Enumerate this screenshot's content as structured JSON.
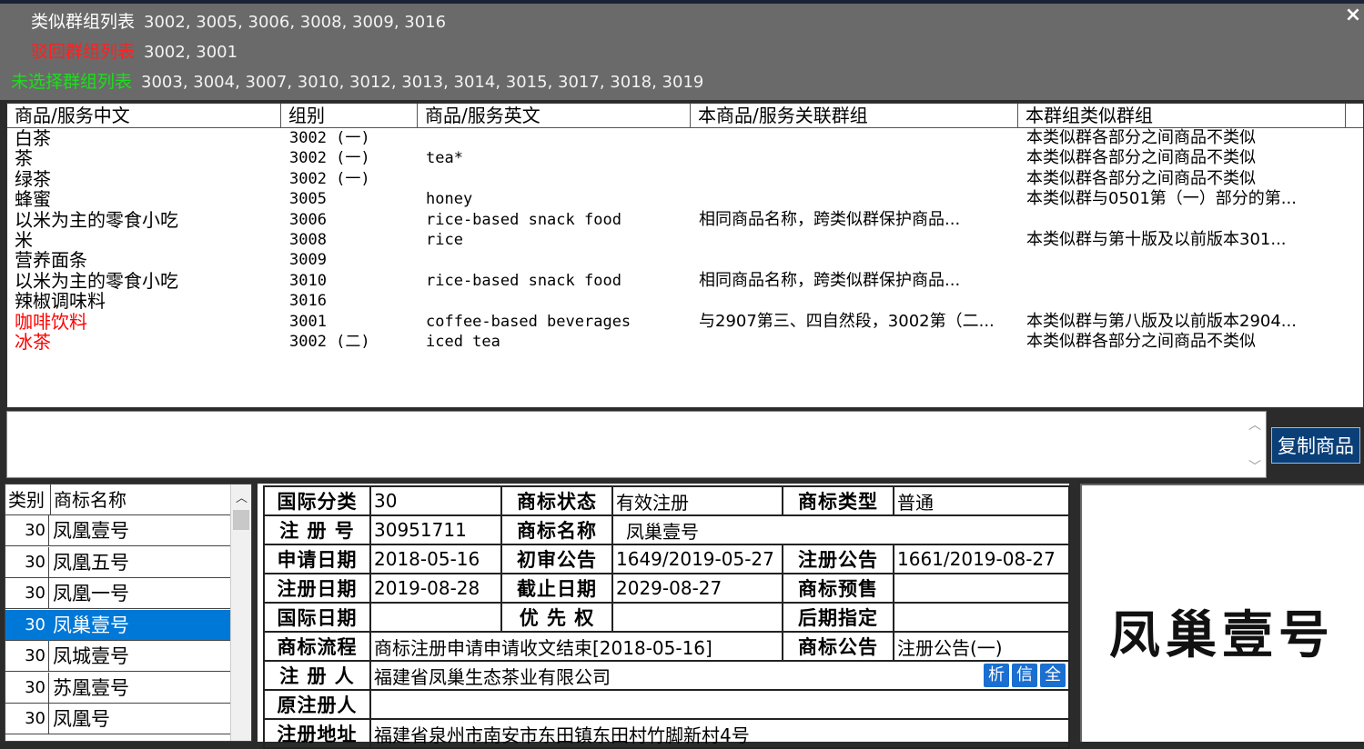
{
  "top": {
    "similar_label": "类似群组列表",
    "similar_values": "3002, 3005, 3006, 3008, 3009, 3016",
    "rejected_label": "驳回群组列表",
    "rejected_values": "3002, 3001",
    "unselected_label": "未选择群组列表",
    "unselected_values": "3003, 3004, 3007, 3010, 3012, 3013, 3014, 3015, 3017, 3018, 3019",
    "colors": {
      "similar": "#ffffff",
      "rejected": "#ff2020",
      "unselected": "#19e019"
    }
  },
  "close_icon": "×",
  "goods_table": {
    "headers": [
      "商品/服务中文",
      "组别",
      "商品/服务英文",
      "本商品/服务关联群组",
      "本群组类似群组"
    ],
    "rows": [
      {
        "cn": "白茶",
        "group": "3002 (一)",
        "en": "",
        "rel": "",
        "sim": "本类似群各部分之间商品不类似",
        "red": false
      },
      {
        "cn": "茶",
        "group": "3002 (一)",
        "en": "tea*",
        "rel": "",
        "sim": "本类似群各部分之间商品不类似",
        "red": false
      },
      {
        "cn": "绿茶",
        "group": "3002 (一)",
        "en": "",
        "rel": "",
        "sim": "本类似群各部分之间商品不类似",
        "red": false
      },
      {
        "cn": "蜂蜜",
        "group": "3005",
        "en": "honey",
        "rel": "",
        "sim": "本类似群与0501第（一）部分的第...",
        "red": false
      },
      {
        "cn": "以米为主的零食小吃",
        "group": "3006",
        "en": "rice-based snack food",
        "rel": "相同商品名称，跨类似群保护商品...",
        "sim": "",
        "red": false
      },
      {
        "cn": "米",
        "group": "3008",
        "en": "rice",
        "rel": "",
        "sim": "本类似群与第十版及以前版本301...",
        "red": false
      },
      {
        "cn": "营养面条",
        "group": "3009",
        "en": "",
        "rel": "",
        "sim": "",
        "red": false
      },
      {
        "cn": "以米为主的零食小吃",
        "group": "3010",
        "en": "rice-based snack food",
        "rel": "相同商品名称，跨类似群保护商品...",
        "sim": "",
        "red": false
      },
      {
        "cn": "辣椒调味料",
        "group": "3016",
        "en": "",
        "rel": "",
        "sim": "",
        "red": false
      },
      {
        "cn": "咖啡饮料",
        "group": "3001",
        "en": "coffee-based beverages",
        "rel": "与2907第三、四自然段，3002第（二...",
        "sim": "本类似群与第八版及以前版本2904...",
        "red": true
      },
      {
        "cn": "冰茶",
        "group": "3002 (二)",
        "en": "iced tea",
        "rel": "",
        "sim": "本类似群各部分之间商品不类似",
        "red": true
      }
    ]
  },
  "copy_button": "复制商品",
  "trademark_list": {
    "headers": [
      "类别",
      "商标名称"
    ],
    "rows": [
      {
        "cls": "30",
        "name": "凤凰壹号",
        "selected": false
      },
      {
        "cls": "30",
        "name": "凤凰五号",
        "selected": false
      },
      {
        "cls": "30",
        "name": "凤凰一号",
        "selected": false
      },
      {
        "cls": "30",
        "name": "凤巢壹号",
        "selected": true
      },
      {
        "cls": "30",
        "name": "凤城壹号",
        "selected": false
      },
      {
        "cls": "30",
        "name": "苏凰壹号",
        "selected": false
      },
      {
        "cls": "30",
        "name": "凤凰号",
        "selected": false
      }
    ]
  },
  "detail": {
    "intl_class_k": "国际分类",
    "intl_class_v": "30",
    "status_k": "商标状态",
    "status_v": "有效注册",
    "type_k": "商标类型",
    "type_v": "普通",
    "reg_no_k": "注 册 号",
    "reg_no_v": "30951711",
    "name_k": "商标名称",
    "name_v": "凤巢壹号",
    "apply_date_k": "申请日期",
    "apply_date_v": "2018-05-16",
    "prelim_k": "初审公告",
    "prelim_v": "1649/2019-05-27",
    "reg_notice_k": "注册公告",
    "reg_notice_v": "1661/2019-08-27",
    "reg_date_k": "注册日期",
    "reg_date_v": "2019-08-28",
    "expire_k": "截止日期",
    "expire_v": "2029-08-27",
    "presale_k": "商标预售",
    "presale_v": "",
    "intl_date_k": "国际日期",
    "intl_date_v": "",
    "priority_k": "优 先 权",
    "priority_v": "",
    "later_k": "后期指定",
    "later_v": "",
    "flow_k": "商标流程",
    "flow_v": "商标注册申请申请收文结束[2018-05-16]",
    "notice_k": "商标公告",
    "notice_v": "注册公告(一)",
    "registrant_k": "注 册 人",
    "registrant_v": "福建省凤巢生态茶业有限公司",
    "orig_reg_k": "原注册人",
    "orig_reg_v": "",
    "address_k": "注册地址",
    "address_v": "福建省泉州市南安市东田镇东田村竹脚新村4号",
    "btn_analyze": "析",
    "btn_credit": "信",
    "btn_all": "全"
  },
  "logo_text": "凤巢壹号"
}
